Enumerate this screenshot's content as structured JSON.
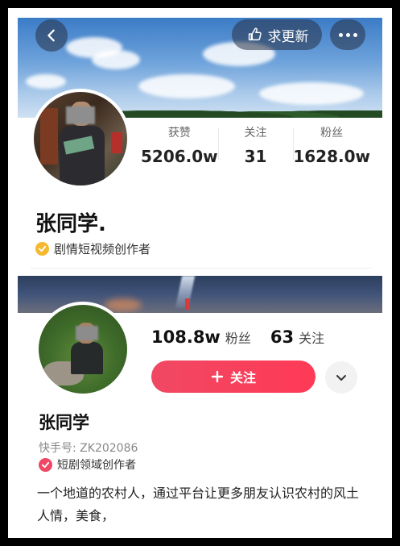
{
  "profile_top": {
    "request_update_label": "求更新",
    "stats": [
      {
        "label": "获赞",
        "value": "5206.0w"
      },
      {
        "label": "关注",
        "value": "31"
      },
      {
        "label": "粉丝",
        "value": "1628.0w"
      }
    ],
    "name": "张同学.",
    "creator_tag": "剧情短视频创作者",
    "tag_color": "#f5b82e"
  },
  "profile_bottom": {
    "followers_value": "108.8w",
    "followers_label": "粉丝",
    "following_value": "63",
    "following_label": "关注",
    "follow_button_label": "关注",
    "name": "张同学",
    "kuaishou_id": "快手号: ZK202086",
    "creator_tag": "短剧领域创作者",
    "tag_color": "#f04864",
    "bio": "一个地道的农村人，通过平台让更多朋友认识农村的风土人情，美食，",
    "accent_color": "#fe3a56"
  },
  "icons": {
    "back": "chevron-left-icon",
    "request_update": "hand-point-icon",
    "more": "more-dots-icon",
    "follow_plus": "plus-icon",
    "dropdown": "chevron-down-icon",
    "verified": "check-badge-icon"
  }
}
